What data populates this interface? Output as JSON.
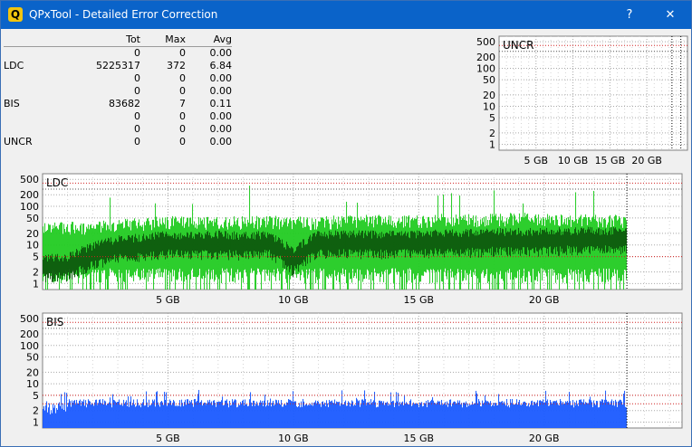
{
  "window": {
    "title": "QPxTool - Detailed Error Correction",
    "icon_letter": "Q",
    "help_label": "?",
    "close_label": "✕"
  },
  "stats": {
    "headers": [
      "",
      "Tot",
      "Max",
      "Avg"
    ],
    "rows": [
      {
        "label": "",
        "tot": "0",
        "max": "0",
        "avg": "0.00"
      },
      {
        "label": "LDC",
        "tot": "5225317",
        "max": "372",
        "avg": "6.84"
      },
      {
        "label": "",
        "tot": "0",
        "max": "0",
        "avg": "0.00"
      },
      {
        "label": "",
        "tot": "0",
        "max": "0",
        "avg": "0.00"
      },
      {
        "label": "BIS",
        "tot": "83682",
        "max": "7",
        "avg": "0.11"
      },
      {
        "label": "",
        "tot": "0",
        "max": "0",
        "avg": "0.00"
      },
      {
        "label": "",
        "tot": "0",
        "max": "0",
        "avg": "0.00"
      },
      {
        "label": "UNCR",
        "tot": "0",
        "max": "0",
        "avg": "0.00"
      }
    ]
  },
  "colors": {
    "titlebar": "#0a63c9",
    "ldc_bright": "#22cc22",
    "ldc_dark": "#0d5a0d",
    "bis": "#1a5aff",
    "ref_line": "#d02020"
  },
  "chart_data": [
    {
      "type": "area",
      "title": "UNCR",
      "yscale": "log",
      "y_ticks": [
        1,
        2,
        5,
        10,
        20,
        50,
        100,
        200,
        500
      ],
      "x_ticks": [
        "5 GB",
        "10 GB",
        "15 GB",
        "20 GB"
      ],
      "x_tick_values": [
        5,
        10,
        15,
        20
      ],
      "xlim": [
        0,
        25.5
      ],
      "ylim": [
        0.7,
        700
      ],
      "series": [
        {
          "values": []
        }
      ]
    },
    {
      "type": "area",
      "title": "LDC",
      "yscale": "log",
      "y_ticks": [
        1,
        2,
        5,
        10,
        20,
        50,
        100,
        200,
        500
      ],
      "x_ticks": [
        "5 GB",
        "10 GB",
        "15 GB",
        "20 GB"
      ],
      "x_tick_values": [
        5,
        10,
        15,
        20
      ],
      "xlim": [
        0,
        25.5
      ],
      "ylim": [
        0.7,
        700
      ],
      "data_end_x": 23.3,
      "max_value": 372,
      "series": [
        {
          "x": [
            0,
            1,
            2,
            3,
            4,
            5,
            6,
            7,
            8,
            9,
            10,
            11,
            12,
            13,
            14,
            15,
            16,
            17,
            18,
            19,
            20,
            21,
            22,
            23
          ],
          "values": [
            30,
            32,
            34,
            38,
            42,
            45,
            44,
            46,
            45,
            47,
            44,
            43,
            48,
            50,
            49,
            50,
            52,
            51,
            53,
            55,
            54,
            52,
            50,
            48
          ]
        },
        {
          "x": [
            0,
            1,
            2,
            3,
            4,
            5,
            6,
            7,
            8,
            9,
            10,
            11,
            12,
            13,
            14,
            15,
            16,
            17,
            18,
            19,
            20,
            21,
            22,
            23
          ],
          "values": [
            3,
            3,
            6,
            9,
            10,
            12,
            11,
            12,
            11,
            12,
            4,
            12,
            12,
            12,
            12,
            12,
            13,
            13,
            14,
            14,
            14,
            15,
            15,
            15
          ]
        }
      ]
    },
    {
      "type": "area",
      "title": "BIS",
      "yscale": "log",
      "y_ticks": [
        1,
        2,
        5,
        10,
        20,
        50,
        100,
        200,
        500
      ],
      "x_ticks": [
        "5 GB",
        "10 GB",
        "15 GB",
        "20 GB"
      ],
      "x_tick_values": [
        5,
        10,
        15,
        20
      ],
      "xlim": [
        0,
        25.5
      ],
      "ylim": [
        0.7,
        700
      ],
      "data_end_x": 23.3,
      "max_value": 7,
      "series": [
        {
          "x": [
            0,
            1,
            2,
            3,
            4,
            5,
            6,
            7,
            8,
            9,
            10,
            11,
            12,
            13,
            14,
            15,
            16,
            17,
            18,
            19,
            20,
            21,
            22,
            23
          ],
          "values": [
            2,
            2,
            3,
            3,
            3,
            3,
            3,
            3,
            3,
            3,
            3,
            3,
            3,
            3,
            3,
            3,
            3,
            3,
            3,
            3,
            3,
            3,
            3,
            3
          ]
        }
      ]
    }
  ]
}
